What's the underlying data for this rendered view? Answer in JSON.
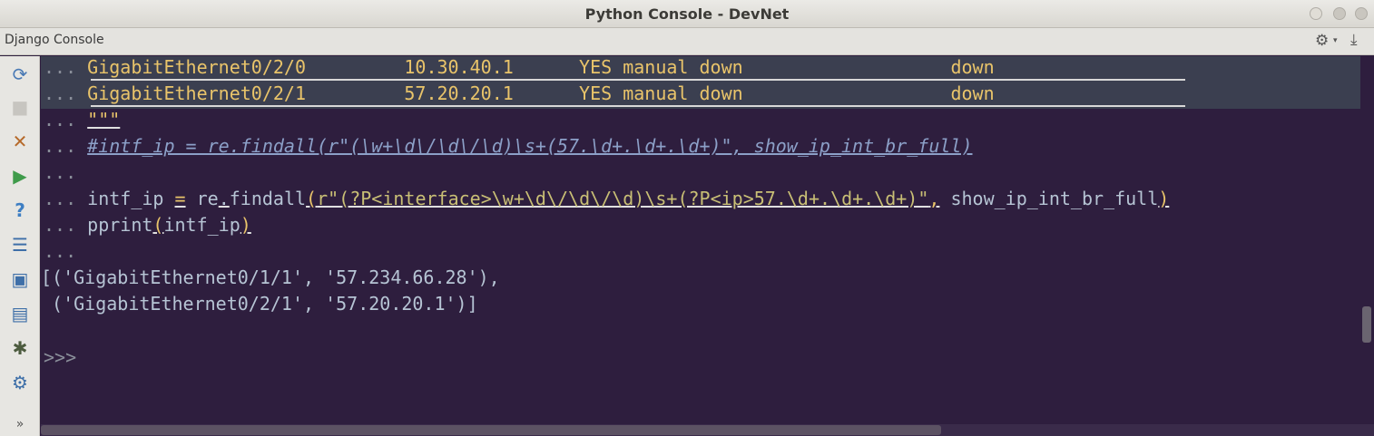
{
  "window": {
    "title": "Python Console - DevNet"
  },
  "toolwindow": {
    "label": "Django Console",
    "gear_icon": "⚙",
    "caret_icon": "▾",
    "pin_icon": "⤓"
  },
  "toolbar": {
    "items": [
      {
        "name": "rerun-icon",
        "glyph": "⟳"
      },
      {
        "name": "stop-icon",
        "glyph": "■"
      },
      {
        "name": "close-icon",
        "glyph": "✕"
      },
      {
        "name": "run-icon",
        "glyph": "▶"
      },
      {
        "name": "help-icon",
        "glyph": "?"
      },
      {
        "name": "settings-sliders-icon",
        "glyph": "☰"
      },
      {
        "name": "image-icon",
        "glyph": "▣"
      },
      {
        "name": "history-icon",
        "glyph": "▤"
      },
      {
        "name": "debug-icon",
        "glyph": "✱"
      },
      {
        "name": "gear-icon",
        "glyph": "⚙"
      },
      {
        "name": "more-icon",
        "glyph": "»"
      }
    ]
  },
  "console": {
    "gutter": "...",
    "lines": [
      {
        "iface": "GigabitEthernet0/2/0",
        "ip": "10.30.40.1",
        "rest": "YES manual down",
        "status": "down"
      },
      {
        "iface": "GigabitEthernet0/2/1",
        "ip": "57.20.20.1",
        "rest": "YES manual down",
        "status": "down"
      }
    ],
    "triple_quote": "\"\"\"",
    "comment_line": "#intf_ip = re.findall(r\"(\\w+\\d\\/\\d\\/\\d)\\s+(57.\\d+.\\d+.\\d+)\", show_ip_int_br_full)",
    "code_line1_a": "intf_ip",
    "code_line1_eq": "=",
    "code_line1_b": "re",
    "code_line1_dot": ".",
    "code_line1_c": "findall",
    "code_line1_paren": "(",
    "code_line1_str": "r\"(?P<interface>\\w+\\d\\/\\d\\/\\d)\\s+(?P<ip>57.\\d+.\\d+.\\d+)\"",
    "code_line1_comma": ",",
    "code_line1_arg": " show_ip_int_br_full",
    "code_line1_close": ")",
    "code_line2_a": "pprint",
    "code_line2_paren": "(",
    "code_line2_arg": "intf_ip",
    "code_line2_close": ")",
    "output_line1": "[('GigabitEthernet0/1/1', '57.234.66.28'),",
    "output_line2": " ('GigabitEthernet0/2/1', '57.20.20.1')]",
    "prompt": ">>>"
  }
}
